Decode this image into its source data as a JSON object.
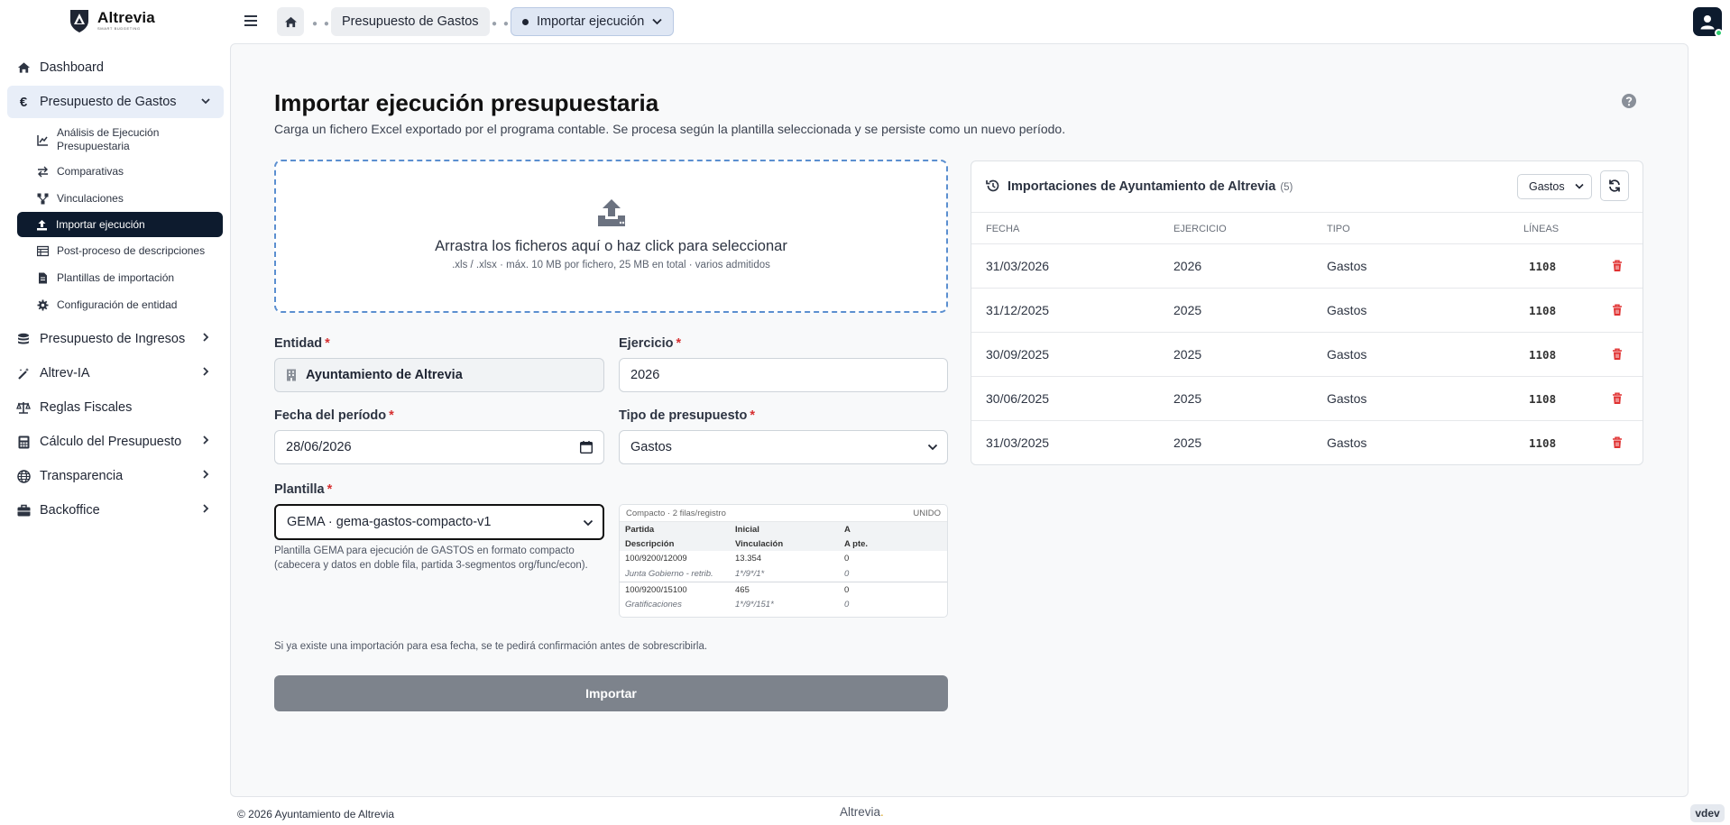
{
  "brand": {
    "name": "Altrevia",
    "tagline": "SMART BUDGETING"
  },
  "sidebar": {
    "items": [
      {
        "label": "Dashboard",
        "icon": "home-icon"
      },
      {
        "label": "Presupuesto de Gastos",
        "icon": "euro-icon",
        "expanded": true,
        "children": [
          {
            "label": "Análisis de Ejecución Presupuestaria",
            "icon": "chart-line-icon"
          },
          {
            "label": "Comparativas",
            "icon": "arrows-exchange-icon"
          },
          {
            "label": "Vinculaciones",
            "icon": "network-icon"
          },
          {
            "label": "Importar ejecución",
            "icon": "upload-icon",
            "active": true
          },
          {
            "label": "Post-proceso de descripciones",
            "icon": "list-table-icon"
          },
          {
            "label": "Plantillas de importación",
            "icon": "file-icon"
          },
          {
            "label": "Configuración de entidad",
            "icon": "gear-icon"
          }
        ]
      },
      {
        "label": "Presupuesto de Ingresos",
        "icon": "coins-icon"
      },
      {
        "label": "Altrev-IA",
        "icon": "magic-wand-icon"
      },
      {
        "label": "Reglas Fiscales",
        "icon": "scale-icon"
      },
      {
        "label": "Cálculo del Presupuesto",
        "icon": "calculator-icon"
      },
      {
        "label": "Transparencia",
        "icon": "globe-icon"
      },
      {
        "label": "Backoffice",
        "icon": "briefcase-icon"
      }
    ]
  },
  "breadcrumb": {
    "level1": "Presupuesto de Gastos",
    "current": "Importar ejecución"
  },
  "page": {
    "title": "Importar ejecución presupuestaria",
    "subtitle": "Carga un fichero Excel exportado por el programa contable. Se procesa según la plantilla seleccionada y se persiste como un nuevo período."
  },
  "dropzone": {
    "title": "Arrastra los ficheros aquí o haz click para seleccionar",
    "hint": ".xls / .xlsx · máx. 10 MB por fichero, 25 MB en total · varios admitidos"
  },
  "form": {
    "entidad": {
      "label": "Entidad",
      "value": "Ayuntamiento de Altrevia"
    },
    "ejercicio": {
      "label": "Ejercicio",
      "value": "2026"
    },
    "fecha": {
      "label": "Fecha del período",
      "value": "28/06/2026"
    },
    "tipo": {
      "label": "Tipo de presupuesto",
      "value": "Gastos"
    },
    "plantilla": {
      "label": "Plantilla",
      "value": "GEMA · gema-gastos-compacto-v1",
      "help": "Plantilla GEMA para ejecución de GASTOS en formato compacto (cabecera y datos en doble fila, partida 3-segmentos org/func/econ)."
    },
    "required_mark": "*",
    "notice": "Si ya existe una importación para esa fecha, se te pedirá confirmación antes de sobrescribirla.",
    "submit_label": "Importar"
  },
  "preview": {
    "caption": "Compacto · 2 filas/registro",
    "badge": "UNIDO",
    "header1": [
      "Partida",
      "Inicial",
      "A"
    ],
    "header2": [
      "Descripción",
      "Vinculación",
      "A pte."
    ],
    "rows": [
      {
        "main": [
          "100/9200/12009",
          "13.354",
          "0"
        ],
        "sub": [
          "Junta Gobierno - retrib.",
          "1*/9*/1*",
          "0"
        ]
      },
      {
        "main": [
          "100/9200/15100",
          "465",
          "0"
        ],
        "sub": [
          "Gratificaciones",
          "1*/9*/151*",
          "0"
        ]
      }
    ]
  },
  "imports": {
    "title": "Importaciones de Ayuntamiento de Altrevia",
    "count": "(5)",
    "filter": "Gastos",
    "columns": [
      "FECHA",
      "EJERCICIO",
      "TIPO",
      "LÍNEAS"
    ],
    "rows": [
      {
        "fecha": "31/03/2026",
        "ejercicio": "2026",
        "tipo": "Gastos",
        "lineas": "1108"
      },
      {
        "fecha": "31/12/2025",
        "ejercicio": "2025",
        "tipo": "Gastos",
        "lineas": "1108"
      },
      {
        "fecha": "30/09/2025",
        "ejercicio": "2025",
        "tipo": "Gastos",
        "lineas": "1108"
      },
      {
        "fecha": "30/06/2025",
        "ejercicio": "2025",
        "tipo": "Gastos",
        "lineas": "1108"
      },
      {
        "fecha": "31/03/2025",
        "ejercicio": "2025",
        "tipo": "Gastos",
        "lineas": "1108"
      }
    ]
  },
  "footer": {
    "copyright": "© 2026 Ayuntamiento de Altrevia",
    "brand": "Altrevia",
    "brand_accent": ".",
    "version": "vdev"
  },
  "colors": {
    "accent": "#0d1b2e",
    "active_group": "#e8eef8",
    "dropzone_border": "#5b8fd0",
    "required": "#d63031",
    "danger": "#e03131"
  }
}
